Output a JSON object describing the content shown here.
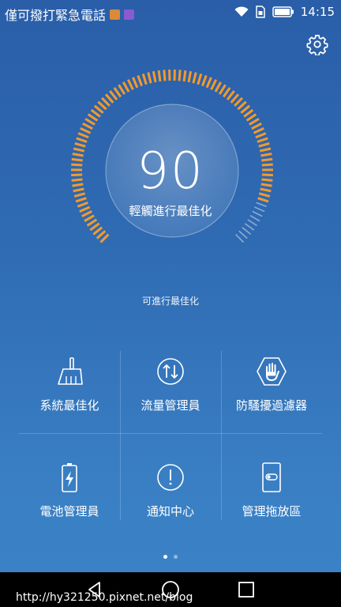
{
  "status_bar": {
    "carrier_text": "僅可撥打緊急電話",
    "time": "14:15",
    "icons": [
      "notification-app-icon",
      "notification-gallery-icon",
      "wifi-icon",
      "sim-icon",
      "battery-icon"
    ]
  },
  "header": {
    "settings_icon": "gear-icon"
  },
  "score": {
    "value": "90",
    "max": 100,
    "label": "輕觸進行最佳化",
    "accent_color": "#f39a2c",
    "status_text": "可進行最佳化"
  },
  "tools": [
    {
      "label": "系統最佳化",
      "icon": "broom-icon"
    },
    {
      "label": "流量管理員",
      "icon": "data-transfer-icon"
    },
    {
      "label": "防騷擾過濾器",
      "icon": "hand-shield-icon"
    },
    {
      "label": "電池管理員",
      "icon": "battery-charging-icon"
    },
    {
      "label": "通知中心",
      "icon": "exclamation-circle-icon"
    },
    {
      "label": "管理拖放區",
      "icon": "phone-toggle-icon"
    }
  ],
  "pager": {
    "current": 1,
    "total": 2
  },
  "nav": {
    "icons": [
      "back-icon",
      "home-icon",
      "recents-icon"
    ]
  },
  "watermark": "http://hy321250.pixnet.net/blog"
}
